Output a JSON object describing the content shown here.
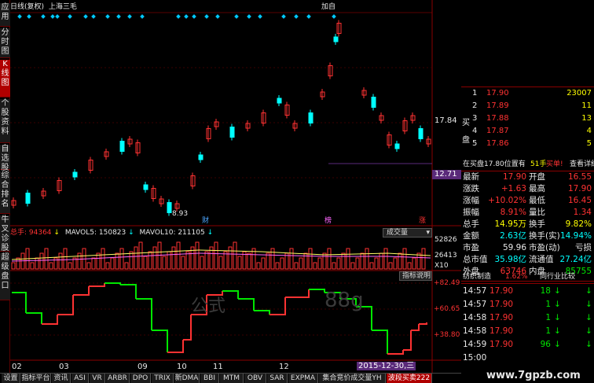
{
  "left_tabs": [
    "应用",
    "分时图",
    "K线图",
    "个股资料",
    "自选股",
    "综合排名",
    "牛叉诊股",
    "超级盘口"
  ],
  "left_tab_active": 2,
  "header": {
    "title": "日线(复权)",
    "stock_name": "上海三毛",
    "right_label": "加自"
  },
  "price_axis": {
    "mark1": "17.84",
    "mark2": "12.71"
  },
  "annotations": {
    "low": "8.93",
    "cai": "财",
    "bang": "榜",
    "zhang": "涨"
  },
  "volume_header": {
    "total": "总手: 94364",
    "mavol5": "MAVOL5: 150823",
    "mavol10": "MAVOL10: 211105",
    "tab": "成交量",
    "ticks": [
      "52826",
      "26413",
      "X10"
    ]
  },
  "indicator_header": {
    "tab": "指标说明",
    "ticks": [
      "+82.49",
      "+60.65",
      "+38.80"
    ]
  },
  "watermark": {
    "a": "公式",
    "b": "88g"
  },
  "dates": [
    "02",
    "03",
    "09",
    "10",
    "11",
    "12"
  ],
  "date_highlight": "2015-12-30,三",
  "bottom_tabs": [
    "设置",
    "指标平台",
    "资讯",
    "ASI",
    "VR",
    "ARBR",
    "DPO",
    "TRIX",
    "新DMA",
    "BBI",
    "MTM",
    "OBV",
    "SAR",
    "EXPMA",
    "集合竞价成交量YH",
    "波段买卖222"
  ],
  "bottom_tab_active": 15,
  "order_book": {
    "side_buy": "买盘",
    "rows": [
      {
        "lvl": "1",
        "price": "17.90",
        "vol": "23007"
      },
      {
        "lvl": "2",
        "price": "17.89",
        "vol": "11"
      },
      {
        "lvl": "3",
        "price": "17.88",
        "vol": "13"
      },
      {
        "lvl": "4",
        "price": "17.87",
        "vol": "4"
      },
      {
        "lvl": "5",
        "price": "17.86",
        "vol": "5"
      }
    ]
  },
  "notice": {
    "a": "在买盘17.80位置有",
    "b": "51手",
    "c": "买单!",
    "d": "查看详细"
  },
  "quote": [
    {
      "l1": "最新",
      "v1": "17.90",
      "l2": "开盘",
      "v2": "16.55"
    },
    {
      "l1": "涨跌",
      "v1": "+1.63",
      "l2": "最高",
      "v2": "17.90"
    },
    {
      "l1": "涨幅",
      "v1": "+10.02%",
      "l2": "最低",
      "v2": "16.45"
    },
    {
      "l1": "振幅",
      "v1": "8.91%",
      "l2": "量比",
      "v2": "1.34"
    },
    {
      "l1": "总手",
      "v1": "14.95万",
      "l2": "换手",
      "v2": "9.82%"
    },
    {
      "l1": "金额",
      "v1": "2.63亿",
      "l2": "换手(实)",
      "v2": "14.94%"
    },
    {
      "l1": "市盈",
      "v1": "59.96",
      "l2": "市盈(动)",
      "v2": "亏损"
    },
    {
      "l1": "总市值",
      "v1": "35.98亿",
      "l2": "流通值",
      "v2": "27.24亿"
    },
    {
      "l1": "外盘",
      "v1": "63746",
      "l2": "内盘",
      "v2": "85755"
    }
  ],
  "industry": {
    "label": "纺织制造",
    "pct": "1.62%",
    "link": "同行业比较"
  },
  "ticks": [
    {
      "t": "14:57",
      "p": "17.90",
      "v": "18",
      "arrow": "↓"
    },
    {
      "t": "14:57",
      "p": "17.90",
      "v": "1",
      "arrow": "↓"
    },
    {
      "t": "14:58",
      "p": "17.90",
      "v": "1",
      "arrow": "↓"
    },
    {
      "t": "14:58",
      "p": "17.90",
      "v": "1",
      "arrow": "↓"
    },
    {
      "t": "14:59",
      "p": "17.90",
      "v": "96",
      "arrow": "↓"
    },
    {
      "t": "15:00",
      "p": "",
      "v": "",
      "arrow": ""
    }
  ],
  "site_watermark": "www.7gpzb.com"
}
